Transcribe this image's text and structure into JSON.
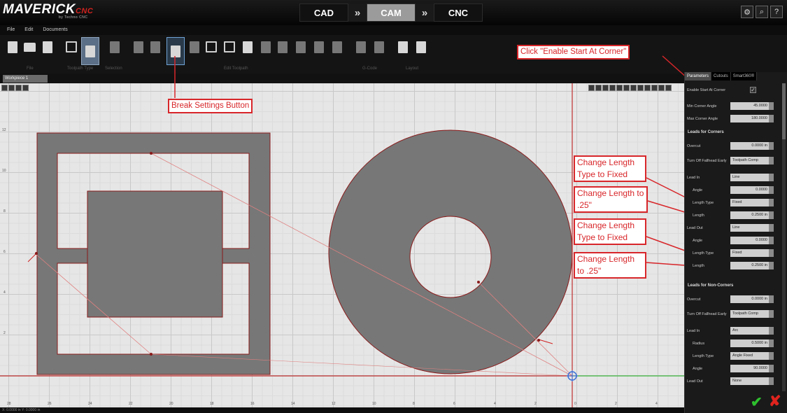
{
  "app": {
    "logo_main": "MAVERICK",
    "logo_sub": "CNC",
    "logo_by": "by Techno CNC"
  },
  "modes": [
    {
      "label": "CAD"
    },
    {
      "label": "CAM"
    },
    {
      "label": "CNC"
    }
  ],
  "mode_arrow": "»",
  "menu": [
    "File",
    "Edit",
    "Documents"
  ],
  "toolbar_groups": [
    "File",
    "Toolpath Type",
    "Selection",
    "Edit Toolpath",
    "G-Code",
    "Layout"
  ],
  "doc_tab": "Workpiece 1",
  "status_text": "X: 0.0000 in  Y: 0.0000 in",
  "callouts": {
    "enable_start": "Click \"Enable Start At Corner\"",
    "break_settings": "Break Settings Button",
    "length_type_1": "Change Length Type to Fixed",
    "length_1": "Change Length to .25\"",
    "length_type_2": "Change Length Type to Fixed",
    "length_2": "Change Length to .25\""
  },
  "panel": {
    "tabs": [
      "Parameters",
      "Cutouts",
      "Smart360®"
    ],
    "enable_start_label": "Enable Start At Corner",
    "enable_start_value": "✓",
    "min_corner_label": "Min Corner Angle",
    "min_corner_value": "45.0000",
    "max_corner_label": "Max Corner Angle",
    "max_corner_value": "180.0000",
    "section_corners": "Leads for Corners",
    "overcut_label": "Overcut",
    "overcut_value": "0.0000 in",
    "turnoff_label": "Turn Off Fallhead Early",
    "turnoff_value": "Toolpath Comp",
    "leadin_label": "Lead In",
    "leadin_value": "Line",
    "angle_label": "Angle",
    "angle_value": "0.0000",
    "lengthtype_label": "Length Type",
    "lengthtype_value": "Fixed",
    "length_label": "Length",
    "length_value": "0.2500 in",
    "leadout_label": "Lead Out",
    "leadout_value": "Line",
    "angle2_label": "Angle",
    "angle2_value": "0.0000",
    "lengthtype2_label": "Length Type",
    "lengthtype2_value": "Fixed",
    "length2_label": "Length",
    "length2_value": "0.2500 in",
    "section_noncorners": "Leads for Non-Corners",
    "overcut2_label": "Overcut",
    "overcut2_value": "0.0000 in",
    "turnoff2_label": "Turn Off Fallhead Early",
    "turnoff2_value": "Toolpath Comp",
    "leadin2_label": "Lead In",
    "leadin2_value": "Arc",
    "radius_label": "Radius",
    "radius_value": "0.5000 in",
    "lengthtype3_label": "Length Type",
    "lengthtype3_value": "Angle Fixed",
    "angle3_label": "Angle",
    "angle3_value": "90.0000",
    "leadout2_label": "Lead Out",
    "leadout2_value": "None"
  },
  "axis_ticks_x": [
    "28",
    "26",
    "24",
    "22",
    "20",
    "18",
    "16",
    "14",
    "12",
    "10",
    "8",
    "6",
    "4",
    "2",
    "0",
    "2",
    "4"
  ],
  "axis_ticks_y": [
    "12",
    "10",
    "8",
    "6",
    "4",
    "2"
  ],
  "colors": {
    "accent": "#d8262a",
    "shape_fill": "#777777",
    "grid": "#c8c8c8",
    "origin": "#3a6fd8",
    "ok": "#2ec02e"
  }
}
